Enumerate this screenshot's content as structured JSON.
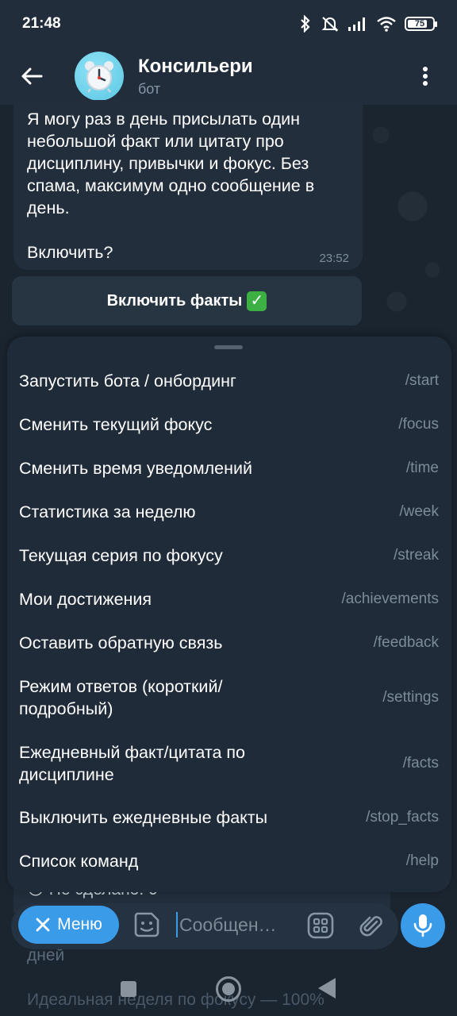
{
  "status_bar": {
    "time": "21:48",
    "battery": "75",
    "icons": [
      "bluetooth-icon",
      "mute-icon",
      "signal-icon",
      "wifi-icon",
      "battery-icon"
    ]
  },
  "header": {
    "title": "Консильери",
    "subtitle": "бот",
    "avatar_icon": "alarm-clock-icon"
  },
  "message": {
    "text": "Я могу раз в день присылать один небольшой факт или цитату про дисциплину, привычки и фокус. Без спама, максимум одно сообщение в день.\n\nВключить?",
    "time": "23:52"
  },
  "inline_button": {
    "label": "Включить факты",
    "emoji": "✓"
  },
  "commands": [
    {
      "label": "Запустить бота / онбординг",
      "command": "/start"
    },
    {
      "label": "Сменить текущий фокус",
      "command": "/focus"
    },
    {
      "label": "Сменить время уведомлений",
      "command": "/time"
    },
    {
      "label": "Статистика за неделю",
      "command": "/week"
    },
    {
      "label": "Текущая серия по фокусу",
      "command": "/streak"
    },
    {
      "label": "Мои достижения",
      "command": "/achievements"
    },
    {
      "label": "Оставить обратную связь",
      "command": "/feedback"
    },
    {
      "label": "Режим ответов (короткий/ подробный)",
      "command": "/settings"
    },
    {
      "label": "Ежедневный факт/цитата по дисциплине",
      "command": "/facts"
    },
    {
      "label": "Выключить ежедневные факты",
      "command": "/stop_facts"
    },
    {
      "label": "Список команд",
      "command": "/help"
    }
  ],
  "behind_messages": {
    "line1": "😔 Не сделано: 0",
    "line2": "дней",
    "line3": "Идеальная неделя по фокусу — 100%"
  },
  "input_bar": {
    "menu_label": "Меню",
    "placeholder": "Сообщен…"
  },
  "colors": {
    "accent": "#3a9be8",
    "sheet": "#1f2b38",
    "header": "#212d3b"
  }
}
